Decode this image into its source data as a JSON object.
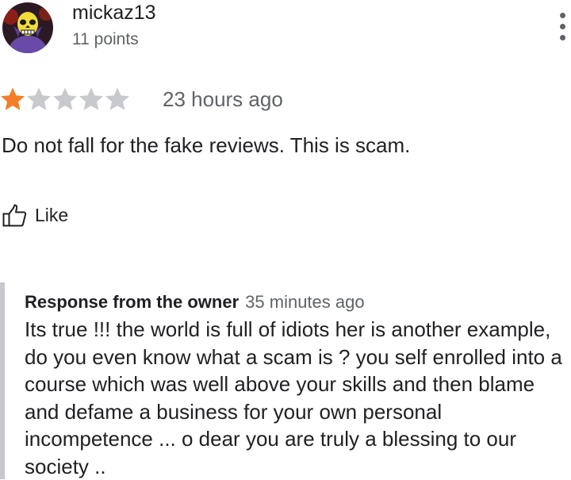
{
  "reviewer": {
    "name": "mickaz13",
    "points": "11 points",
    "avatar_icon": "skull-avatar"
  },
  "menu": {
    "icon": "more-vert-icon"
  },
  "rating": {
    "value": 1,
    "max": 5,
    "filled_color": "#f47d29",
    "empty_color": "#c7c9cc",
    "time": "23 hours ago"
  },
  "review": {
    "text": "Do not fall for the fake reviews. This is scam."
  },
  "like": {
    "label": "Like",
    "icon": "thumbs-up-icon"
  },
  "response": {
    "title": "Response from the owner",
    "time": "35 minutes ago",
    "text": "Its true !!! the world is full of idiots her is another example, do you even know what a scam is ? you self enrolled into a course which was well above your skills and then blame and defame a business for your own personal incompetence ... o dear you are truly a blessing to our society .."
  }
}
